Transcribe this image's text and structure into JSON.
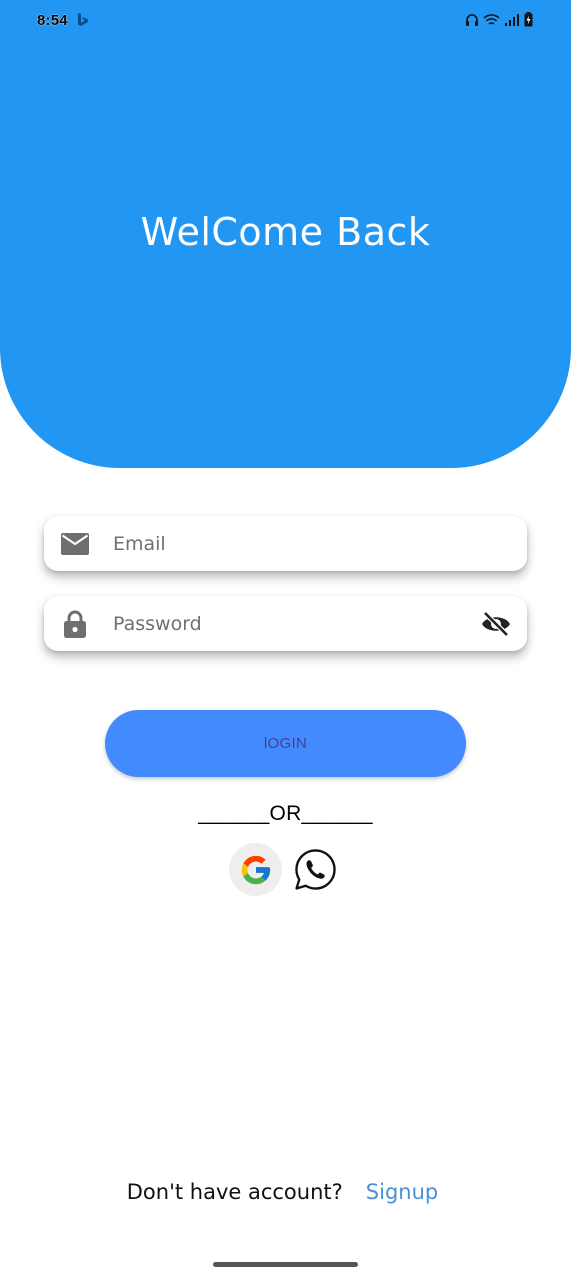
{
  "status_bar": {
    "time": "8:54",
    "app_icon": "bing-icon",
    "right_icons": [
      "headphones-icon",
      "wifi-icon",
      "signal-icon",
      "battery-charging-icon"
    ]
  },
  "header": {
    "title": "WelCome Back",
    "background_color": "#2196f3"
  },
  "email_field": {
    "icon": "mail-icon",
    "placeholder": "Email",
    "value": ""
  },
  "password_field": {
    "icon": "lock-icon",
    "placeholder": "Password",
    "value": "",
    "toggle_icon": "visibility-off-icon"
  },
  "login_button": {
    "label": "lOGIN",
    "color": "#448aff"
  },
  "divider": {
    "text": "______OR______"
  },
  "social": {
    "google_icon": "google-icon",
    "whatsapp_icon": "whatsapp-icon"
  },
  "footer": {
    "prompt": "Don't have account?",
    "signup_label": "Signup",
    "link_color": "#4a90d9"
  }
}
